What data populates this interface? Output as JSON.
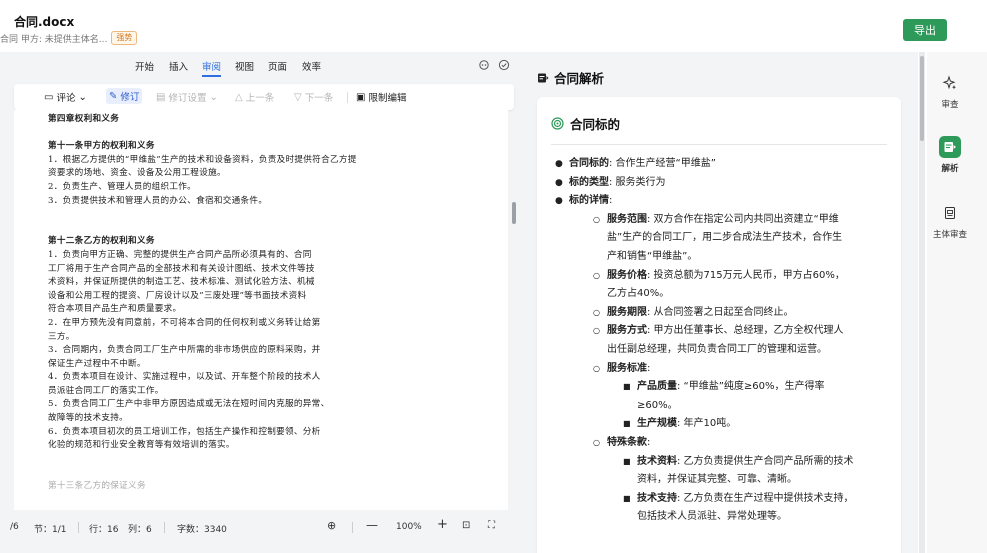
{
  "header": {
    "doc_title": "合同.docx",
    "doc_subtitle": "合同  甲方: 未提供主体名...",
    "tag": "强势",
    "export_label": "导出"
  },
  "ribbon": {
    "tabs": [
      "开始",
      "插入",
      "审阅",
      "视图",
      "页面",
      "效率"
    ],
    "active_tab": "审阅"
  },
  "toolbar": {
    "comment": "评论",
    "revise": "修订",
    "revise_settings": "修订设置",
    "prev": "上一条",
    "next": "下一条",
    "restrict": "限制编辑"
  },
  "document": {
    "lines": [
      {
        "text": "第四章权利和义务",
        "style": "head"
      },
      {
        "text": "",
        "style": "gap"
      },
      {
        "text": "第十一条甲方的权利和义务",
        "style": "head"
      },
      {
        "text": "1．根据乙方提供的“甲维盐”生产的技术和设备资料，负责及时提供符合乙方提",
        "style": ""
      },
      {
        "text": "资要求的场地、资金、设备及公用工程设施。",
        "style": ""
      },
      {
        "text": "2．负责生产、管理人员的组织工作。",
        "style": ""
      },
      {
        "text": "3．负责提供技术和管理人员的办公、食宿和交通条件。",
        "style": ""
      },
      {
        "text": "",
        "style": "gap"
      },
      {
        "text": "",
        "style": "gap"
      },
      {
        "text": "第十二条乙方的权利和义务",
        "style": "head"
      },
      {
        "text": "1．负责向甲方正确、完整的提供生产合同产品所必须具有的、合同",
        "style": ""
      },
      {
        "text": "工厂将用于生产合同产品的全部技术和有关设计图纸、技术文件等技",
        "style": ""
      },
      {
        "text": "术资料，并保证所提供的制造工艺、技术标准、测试化验方法、机械",
        "style": ""
      },
      {
        "text": "设备和公用工程的提资、厂房设计以及”三废处理”等书面技术资料",
        "style": ""
      },
      {
        "text": "符合本项目产品生产和质量要求。",
        "style": ""
      },
      {
        "text": "2．在甲方预先没有同意前，不可将本合同的任何权利或义务转让给第",
        "style": ""
      },
      {
        "text": "三方。",
        "style": ""
      },
      {
        "text": "3．合同期内，负责合同工厂生产中所需的非市场供应的原料采购，并",
        "style": ""
      },
      {
        "text": "保证生产过程中不中断。",
        "style": ""
      },
      {
        "text": "4．负责本项目在设计、实施过程中，以及试、开车整个阶段的技术人",
        "style": ""
      },
      {
        "text": "员派驻合同工厂的落实工作。",
        "style": ""
      },
      {
        "text": "5．负责合同工厂生产中非甲方原因造成或无法在短时间内克服的异常、",
        "style": ""
      },
      {
        "text": "故障等的技术支持。",
        "style": ""
      },
      {
        "text": "6．负责本项目初次的员工培训工作，包括生产操作和控制要领、分析",
        "style": ""
      },
      {
        "text": "化验的规范和行业安全教育等有效培训的落实。",
        "style": ""
      },
      {
        "text": "",
        "style": "gap"
      },
      {
        "text": "",
        "style": "gap"
      },
      {
        "text": "第十三条乙方的保证义务",
        "style": "faded"
      }
    ]
  },
  "statusbar": {
    "page": "/6",
    "section": "节：1/1",
    "line": "行：16",
    "col": "列：6",
    "words": "字数：3340",
    "zoom": "100%"
  },
  "analysis": {
    "pane_title": "合同解析",
    "card_title": "合同标的",
    "rows": [
      {
        "level": 1,
        "key": "合同标的",
        "text": ": 合作生产经营“甲维盐”"
      },
      {
        "level": 1,
        "key": "标的类型",
        "text": ": 服务类行为"
      },
      {
        "level": 1,
        "key": "标的详情",
        "text": ":"
      },
      {
        "level": 2,
        "key": "服务范围",
        "text": ": 双方合作在指定公司内共同出资建立“甲维"
      },
      {
        "level": 2,
        "key": "",
        "text": "盐”生产的合同工厂，用二步合成法生产技术，合作生"
      },
      {
        "level": 2,
        "key": "",
        "text": "产和销售“甲维盐”。"
      },
      {
        "level": 2,
        "key": "服务价格",
        "text": ": 投资总额为715万元人民币，甲方占60%，"
      },
      {
        "level": 2,
        "key": "",
        "text": "乙方占40%。"
      },
      {
        "level": 2,
        "key": "服务期限",
        "text": ": 从合同签署之日起至合同终止。"
      },
      {
        "level": 2,
        "key": "服务方式",
        "text": ": 甲方出任董事长、总经理，乙方全权代理人"
      },
      {
        "level": 2,
        "key": "",
        "text": "出任副总经理，共同负责合同工厂的管理和运营。"
      },
      {
        "level": 2,
        "key": "服务标准",
        "text": ":"
      },
      {
        "level": 3,
        "key": "产品质量",
        "text": ": “甲维盐”纯度≥60%，生产得率"
      },
      {
        "level": 3,
        "key": "",
        "text": "≥60%。"
      },
      {
        "level": 3,
        "key": "生产规模",
        "text": ": 年产10吨。"
      },
      {
        "level": 2,
        "key": "特殊条款",
        "text": ":"
      },
      {
        "level": 3,
        "key": "技术资料",
        "text": ": 乙方负责提供生产合同产品所需的技术"
      },
      {
        "level": 3,
        "key": "",
        "text": "资料，并保证其完整、可靠、清晰。"
      },
      {
        "level": 3,
        "key": "技术支持",
        "text": ": 乙方负责在生产过程中提供技术支持，"
      },
      {
        "level": 3,
        "key": "",
        "text": "包括技术人员派驻、异常处理等。"
      }
    ]
  },
  "rail": {
    "items": [
      {
        "label": "审查",
        "icon": "sparkle-icon"
      },
      {
        "label": "解析",
        "icon": "parse-doc-icon"
      },
      {
        "label": "主体审查",
        "icon": "entity-doc-icon"
      }
    ]
  },
  "colors": {
    "accent_green": "#2e9a5a",
    "accent_blue": "#2f6fe0",
    "tag_orange": "#d4781c"
  }
}
